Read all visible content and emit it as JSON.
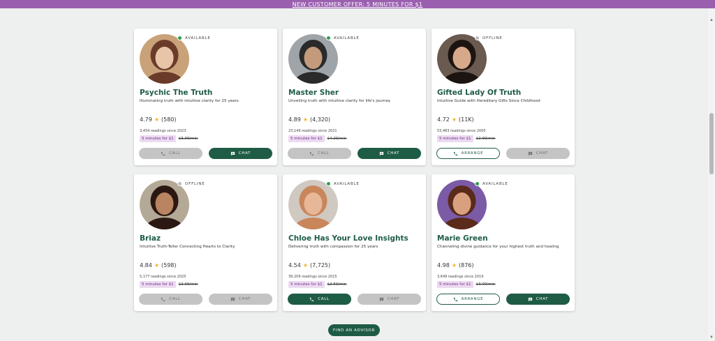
{
  "banner": {
    "text": "NEW CUSTOMER OFFER: 5 MINUTES FOR $1"
  },
  "colors": {
    "banner": "#9b5fb0",
    "brand_green": "#1f5c45",
    "available": "#2e9d4e",
    "offline": "#bdbdbd",
    "promo_bg": "#ecdaf1",
    "star": "#f1b52b"
  },
  "advisors": [
    {
      "name": "Psychic The Truth",
      "status": "AVAILABLE",
      "tagline": "Illuminating truth with intuitive clarity for 25 years",
      "rating": "4.79",
      "reviews": "(580)",
      "readings": "3,454 readings since 2023",
      "promo": "5 minutes for $1",
      "old_price": "$3.09/min",
      "buttons": [
        {
          "label": "CALL",
          "icon": "phone-icon",
          "style": "disabled"
        },
        {
          "label": "CHAT",
          "icon": "chat-icon",
          "style": "primary"
        }
      ]
    },
    {
      "name": "Master Sher",
      "status": "AVAILABLE",
      "tagline": "Unveiling truth with intuitive clarity for life's journey",
      "rating": "4.89",
      "reviews": "(4,320)",
      "readings": "23,149 readings since 2021",
      "promo": "5 minutes for $1",
      "old_price": "$4.29/min",
      "buttons": [
        {
          "label": "CALL",
          "icon": "phone-icon",
          "style": "disabled"
        },
        {
          "label": "CHAT",
          "icon": "chat-icon",
          "style": "primary"
        }
      ]
    },
    {
      "name": "Gifted Lady Of Truth",
      "status": "OFFLINE",
      "tagline": "Intuitive Guide with Hereditary Gifts Since Childhood",
      "rating": "4.72",
      "reviews": "(11K)",
      "readings": "53,483 readings since 2005",
      "promo": "5 minutes for $1",
      "old_price": "$2.99/min",
      "buttons": [
        {
          "label": "ARRANGE",
          "icon": "phone-icon",
          "style": "outline"
        },
        {
          "label": "CHAT",
          "icon": "chat-icon",
          "style": "disabled"
        }
      ]
    },
    {
      "name": "Briaz",
      "status": "OFFLINE",
      "tagline": "Intuitive Truth-Teller Connecting Hearts to Clarity",
      "rating": "4.84",
      "reviews": "(598)",
      "readings": "5,177 readings since 2025",
      "promo": "5 minutes for $1",
      "old_price": "$2.99/min",
      "buttons": [
        {
          "label": "CALL",
          "icon": "phone-icon",
          "style": "disabled"
        },
        {
          "label": "CHAT",
          "icon": "chat-icon",
          "style": "disabled"
        }
      ]
    },
    {
      "name": "Chloe Has Your Love Insights",
      "status": "AVAILABLE",
      "tagline": "Delivering truth with compassion for 25 years",
      "rating": "4.54",
      "reviews": "(7,725)",
      "readings": "39,209 readings since 2015",
      "promo": "5 minutes for $1",
      "old_price": "$2.59/min",
      "buttons": [
        {
          "label": "CALL",
          "icon": "phone-icon",
          "style": "primary"
        },
        {
          "label": "CHAT",
          "icon": "chat-icon",
          "style": "disabled"
        }
      ]
    },
    {
      "name": "Marie Green",
      "status": "AVAILABLE",
      "tagline": "Channeling divine guidance for your highest truth and healing",
      "rating": "4.98",
      "reviews": "(876)",
      "readings": "3,649 readings since 2019",
      "promo": "5 minutes for $1",
      "old_price": "$3.00/min",
      "buttons": [
        {
          "label": "ARRANGE",
          "icon": "phone-icon",
          "style": "outline"
        },
        {
          "label": "CHAT",
          "icon": "chat-icon",
          "style": "primary"
        }
      ]
    }
  ],
  "footer": {
    "find_label": "FIND AN ADVISOR"
  }
}
